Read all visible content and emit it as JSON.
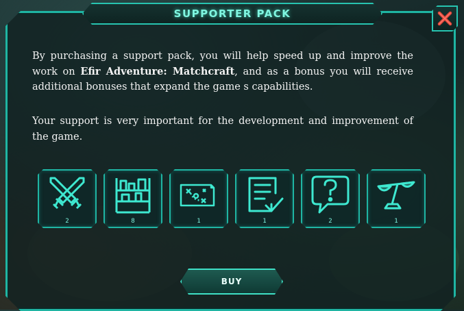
{
  "title": "SUPPORTER PACK",
  "paragraph1": {
    "before": "By purchasing a support pack, you will help speed up and improve the work on ",
    "game_name": "Efir Adventure: Matchcraft",
    "after": ", and as a bonus you will receive additional bonuses that expand the game s capabilities."
  },
  "paragraph2": "Your support is very important for the development and improvement of the game.",
  "items": [
    {
      "icon": "crossed-swords-icon",
      "count": "2"
    },
    {
      "icon": "shelves-icon",
      "count": "8"
    },
    {
      "icon": "treasure-map-icon",
      "count": "1"
    },
    {
      "icon": "checklist-icon",
      "count": "1"
    },
    {
      "icon": "question-bubble-icon",
      "count": "2"
    },
    {
      "icon": "scales-icon",
      "count": "1"
    }
  ],
  "buy_label": "BUY",
  "colors": {
    "accent": "#1fb5a3",
    "glow": "#7ff5e0",
    "close": "#c0392b"
  }
}
